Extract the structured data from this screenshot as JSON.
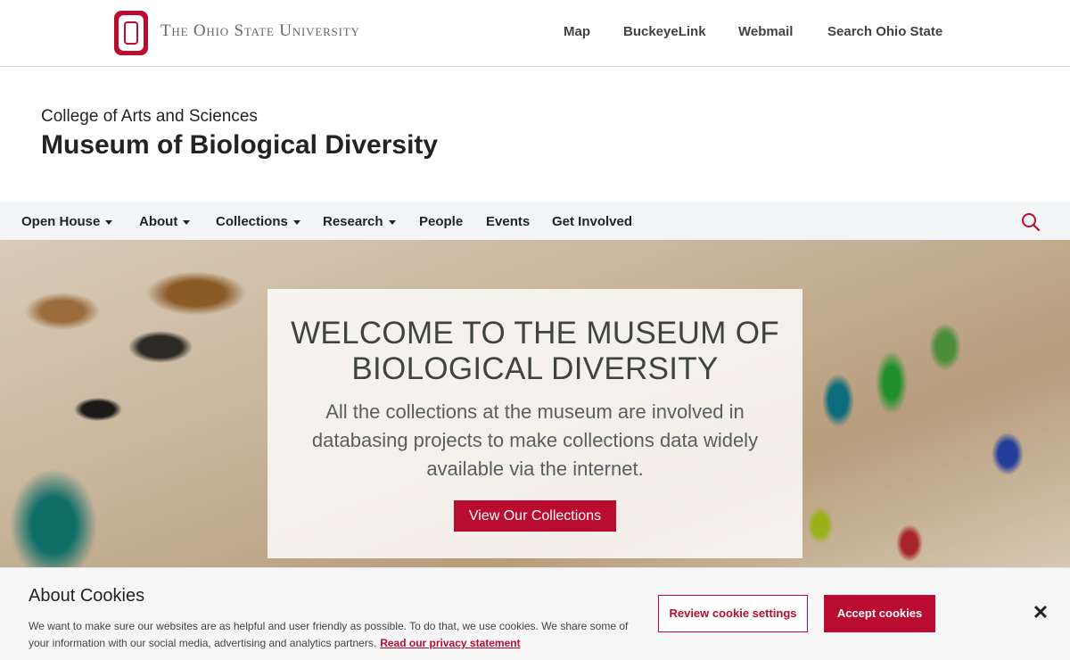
{
  "osu_bar": {
    "wordmark": "The Ohio State University",
    "links": [
      "Map",
      "BuckeyeLink",
      "Webmail",
      "Search Ohio State"
    ]
  },
  "header": {
    "college": "College of Arts and Sciences",
    "title": "Museum of Biological Diversity"
  },
  "nav": {
    "items": [
      {
        "label": "Open House",
        "dropdown": true
      },
      {
        "label": "About",
        "dropdown": true
      },
      {
        "label": "Collections",
        "dropdown": true
      },
      {
        "label": "Research",
        "dropdown": true
      },
      {
        "label": "People",
        "dropdown": false
      },
      {
        "label": "Events",
        "dropdown": false
      },
      {
        "label": "Get Involved",
        "dropdown": false
      }
    ],
    "search_icon": "search-icon"
  },
  "hero": {
    "title": "WELCOME TO THE MUSEUM OF BIOLOGICAL DIVERSITY",
    "text": "All the collections at the museum are involved in databasing projects to make collections data widely available via the internet.",
    "button_label": "View Our Collections"
  },
  "cookie": {
    "title": "About Cookies",
    "text": "We want to make sure our websites are as helpful and user friendly as possible. To do that, we use cookies. We share some of your information with our social media, advertising and analytics partners.",
    "link": "Read our privacy statement",
    "review_label": "Review cookie settings",
    "accept_label": "Accept cookies",
    "close_icon": "close-icon"
  },
  "colors": {
    "brand": "#ba0c2f",
    "nav_bg": "#f4f5f7"
  }
}
